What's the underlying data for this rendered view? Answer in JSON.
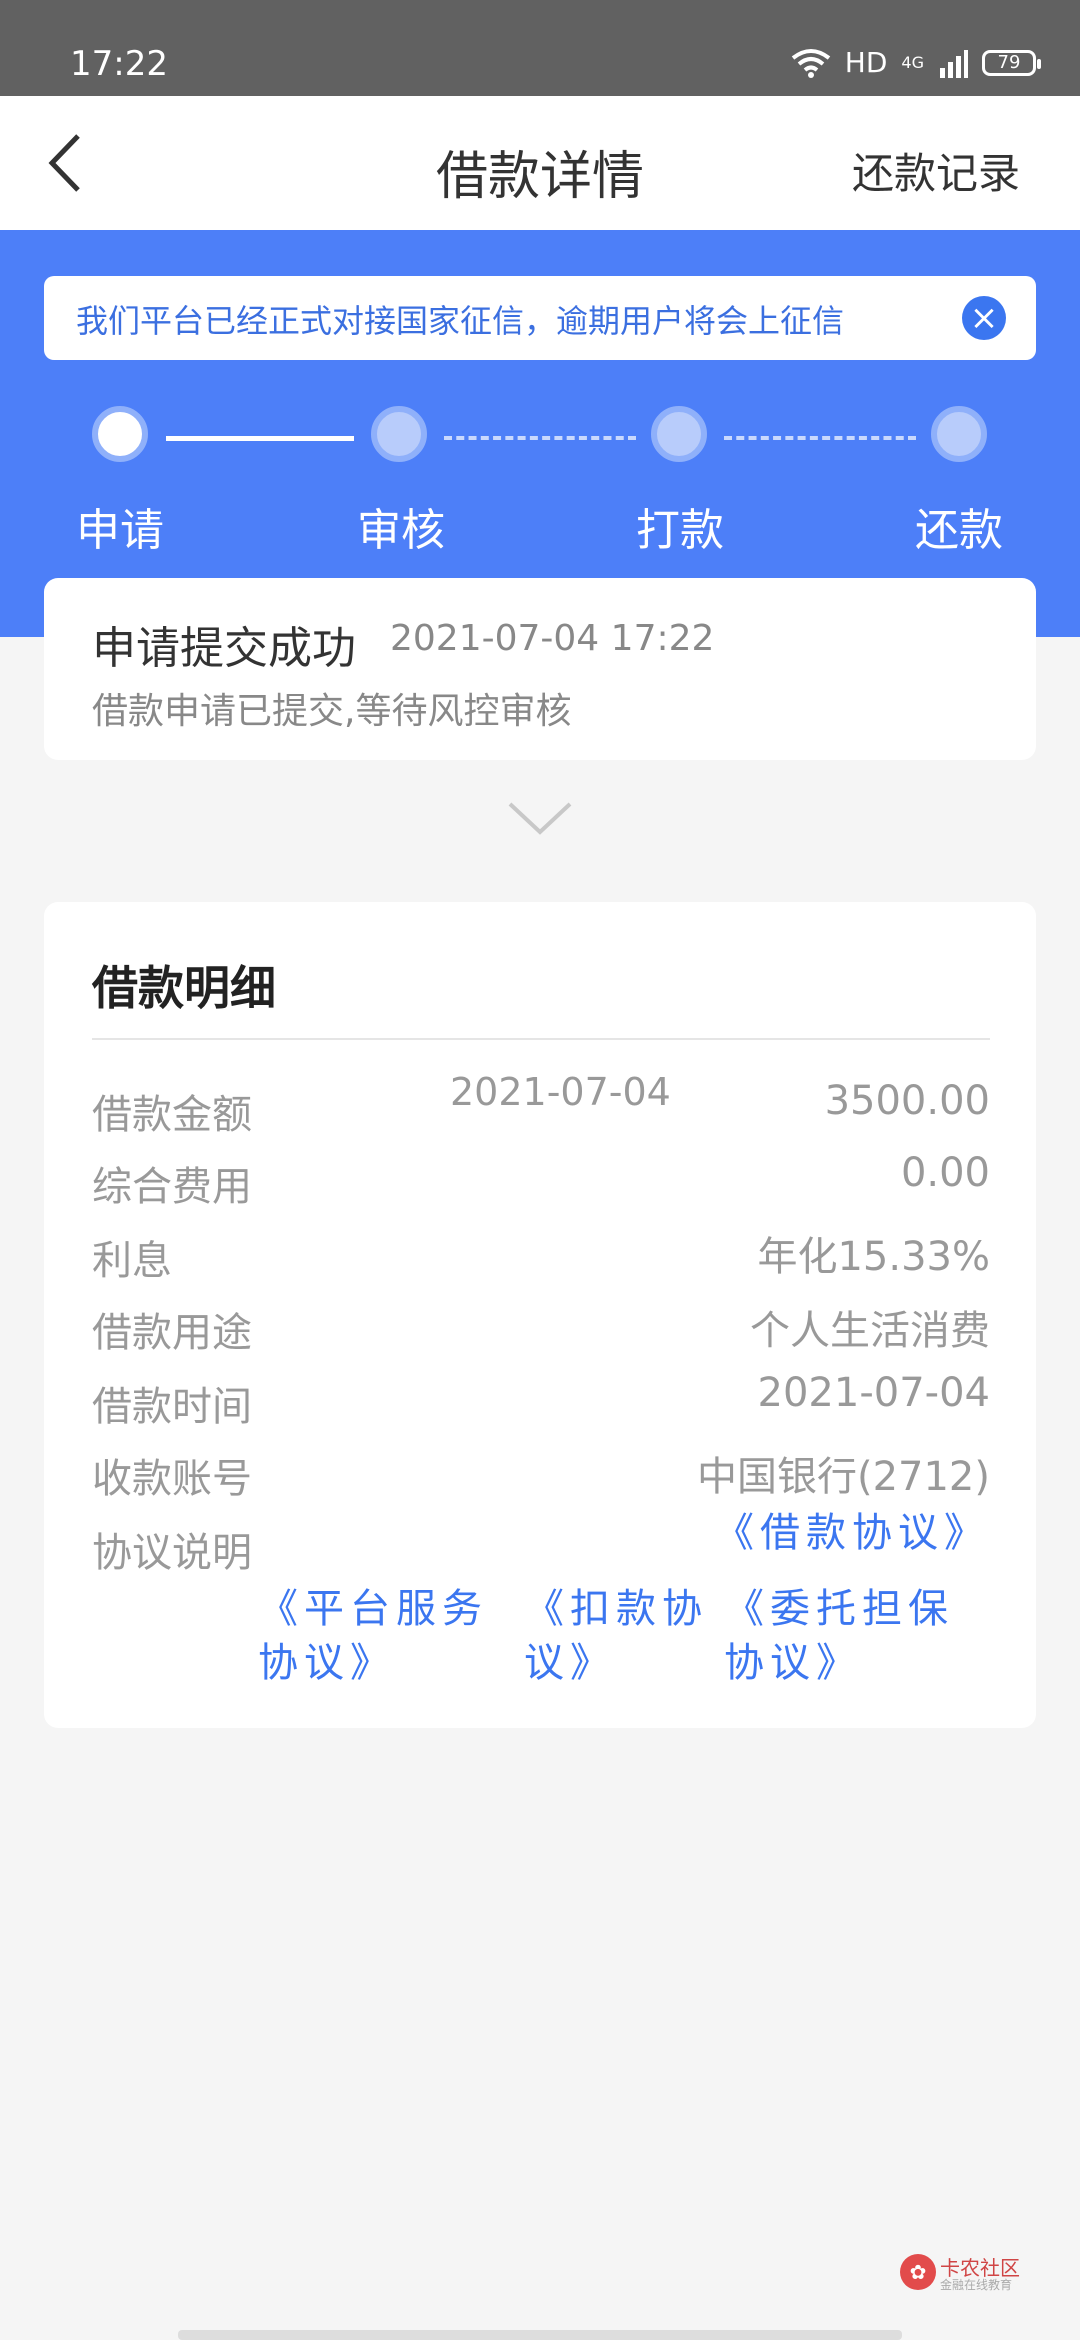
{
  "status_bar": {
    "time": "17:22",
    "network": "HD",
    "signal": "4G",
    "battery": "79"
  },
  "nav": {
    "title": "借款详情",
    "right_action": "还款记录"
  },
  "notice": {
    "text": "我们平台已经正式对接国家征信，逾期用户将会上征信"
  },
  "steps": [
    {
      "label": "申请",
      "active": true
    },
    {
      "label": "审核",
      "active": false
    },
    {
      "label": "打款",
      "active": false
    },
    {
      "label": "还款",
      "active": false
    }
  ],
  "status_card": {
    "title": "申请提交成功",
    "time": "2021-07-04 17:22",
    "desc": "借款申请已提交,等待风控审核"
  },
  "detail": {
    "title": "借款明细",
    "date": "2021-07-04",
    "rows": [
      {
        "label": "借款金额",
        "value": "3500.00"
      },
      {
        "label": "综合费用",
        "value": "0.00"
      },
      {
        "label": "利息",
        "value": "年化15.33%"
      },
      {
        "label": "借款用途",
        "value": "个人生活消费"
      },
      {
        "label": "借款时间",
        "value": "2021-07-04"
      },
      {
        "label": "收款账号",
        "value": "中国银行(2712)"
      },
      {
        "label": "协议说明",
        "value": ""
      }
    ],
    "agreements": {
      "loan": "《借款协议》",
      "platform_line1": "《平台服务",
      "platform_line2": "协议》",
      "deduction_line1": "《扣款协",
      "deduction_line2": "议》",
      "guarantee_line1": "《委托担保",
      "guarantee_line2": "协议》"
    }
  },
  "watermark": {
    "title": "卡农社区",
    "subtitle": "金融在线教育"
  },
  "colors": {
    "primary": "#4d7ff8",
    "link": "#3b76f0",
    "background": "#f5f5f5"
  }
}
